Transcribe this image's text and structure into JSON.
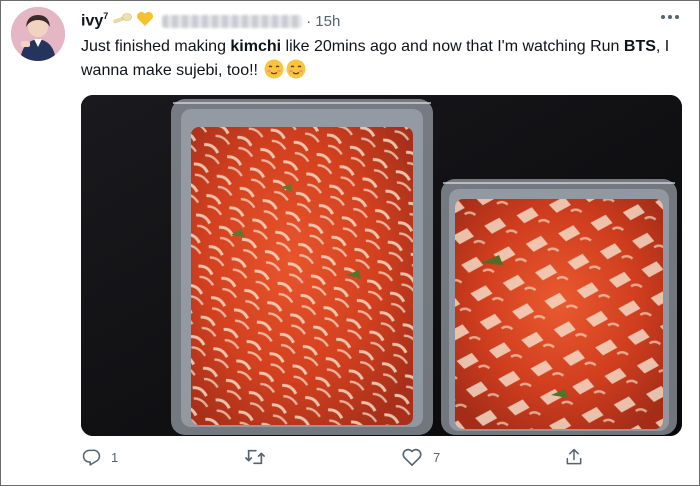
{
  "tweet": {
    "author": {
      "name": "ivy",
      "name_sup": "7"
    },
    "time": "15h",
    "text_parts": {
      "p1": "Just finished making ",
      "bold1": "kimchi",
      "p2": " like 20mins ago and now that I'm watching Run ",
      "bold2": "BTS",
      "p3": ", I wanna make sujebi, too!!"
    }
  },
  "actions": {
    "reply_count": "1",
    "retweet_count": "",
    "like_count": "7"
  },
  "icons": {
    "reply": "reply-icon",
    "retweet": "retweet-icon",
    "like": "heart-icon",
    "share": "share-icon",
    "more": "more-icon"
  },
  "colors": {
    "icon_gray": "#536471",
    "text": "#0f1419",
    "kimchi": "#d2401f"
  }
}
